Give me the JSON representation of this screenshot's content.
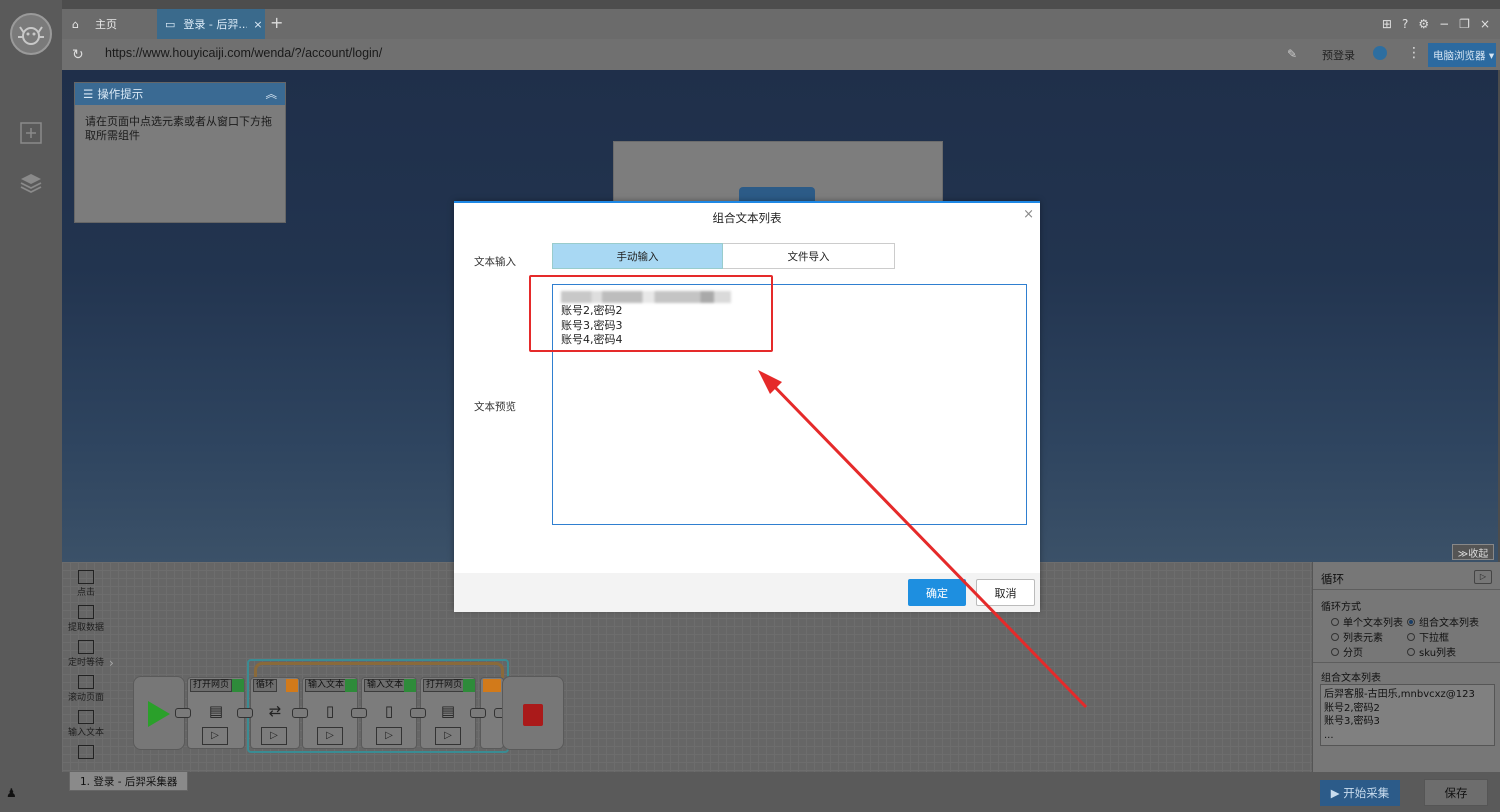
{
  "tabs": {
    "home_label": "主页",
    "active_label": "登录 - 后羿...",
    "close_glyph": "×",
    "new_glyph": "+"
  },
  "window_controls": [
    "⊞",
    "?",
    "⚙",
    "−",
    "❐",
    "×"
  ],
  "address": {
    "url": "https://www.houyicaiji.com/wenda/?/account/login/",
    "pre_login": "预登录",
    "browser_mode": "电脑浏览器 ▾"
  },
  "tips": {
    "title": "操作提示",
    "body": "请在页面中点选元素或者从窗口下方拖取所需组件"
  },
  "collapse_label": "≫收起",
  "palette": [
    {
      "label": "点击"
    },
    {
      "label": "提取数据"
    },
    {
      "label": "定时等待"
    },
    {
      "label": "滚动页面"
    },
    {
      "label": "输入文本"
    }
  ],
  "workflow_nodes": [
    "打开网页",
    "循环",
    "输入文本",
    "输入文本",
    "打开网页"
  ],
  "status_tab": "1. 登录 - 后羿采集器",
  "props": {
    "title": "循环",
    "loop_mode_label": "循环方式",
    "options": [
      "单个文本列表",
      "组合文本列表",
      "列表元素",
      "下拉框",
      "分页",
      "sku列表"
    ],
    "selected": "组合文本列表",
    "list_label": "组合文本列表",
    "list_lines": [
      "后羿客服-古田乐,mnbvcxz@123",
      "账号2,密码2",
      "账号3,密码3",
      "..."
    ]
  },
  "bottom": {
    "start": "▶ 开始采集",
    "save": "保存"
  },
  "dialog": {
    "title": "组合文本列表",
    "close": "×",
    "input_label": "文本输入",
    "tab_manual": "手动输入",
    "tab_file": "文件导入",
    "lines": [
      "账号2,密码2",
      "账号3,密码3",
      "账号4,密码4"
    ],
    "preview_label": "文本预览",
    "ok": "确定",
    "cancel": "取消"
  },
  "colors": {
    "accent": "#1e8fe0",
    "annotation": "#e52a2a",
    "selected_tab": "#a8d8f3"
  }
}
